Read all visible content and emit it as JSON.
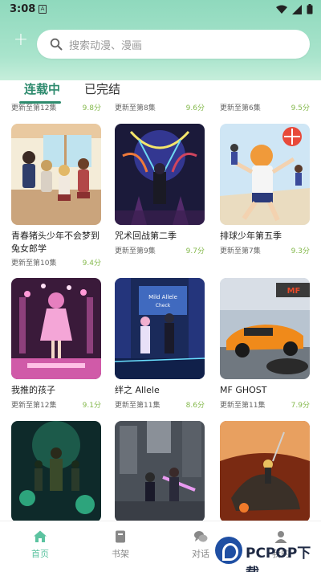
{
  "status": {
    "time": "3:08"
  },
  "search": {
    "placeholder": "搜索动漫、漫画"
  },
  "tabs": [
    {
      "label": "连载中"
    },
    {
      "label": "已完结"
    }
  ],
  "partial_row": [
    {
      "update": "更新至第12集",
      "score": "9.8分"
    },
    {
      "update": "更新至第8集",
      "score": "9.6分"
    },
    {
      "update": "更新至第6集",
      "score": "9.5分"
    }
  ],
  "cards": [
    {
      "title": "青春猪头少年不会梦到兔女郎学",
      "update": "更新至第10集",
      "score": "9.4分"
    },
    {
      "title": "咒术回战第二季",
      "update": "更新至第9集",
      "score": "9.7分"
    },
    {
      "title": "排球少年第五季",
      "update": "更新至第7集",
      "score": "9.3分"
    },
    {
      "title": "我推的孩子",
      "update": "更新至第12集",
      "score": "9.1分"
    },
    {
      "title": "绊之 Allele",
      "update": "更新至第11集",
      "score": "8.6分"
    },
    {
      "title": "MF GHOST",
      "update": "更新至第11集",
      "score": "7.9分"
    },
    {
      "title": "",
      "update": "",
      "score": ""
    },
    {
      "title": "",
      "update": "",
      "score": ""
    },
    {
      "title": "",
      "update": "",
      "score": ""
    }
  ],
  "covers": {
    "c3_sign": "MF",
    "c4_screen": "Mild Allele Check"
  },
  "nav": [
    {
      "label": "首页",
      "icon": "home-icon"
    },
    {
      "label": "书架",
      "icon": "bookshelf-icon"
    },
    {
      "label": "对话",
      "icon": "chat-icon"
    },
    {
      "label": "我的",
      "icon": "user-icon"
    }
  ],
  "watermark": {
    "text": "PCPOP下载"
  },
  "colors": {
    "accent": "#2e8b6e",
    "header": "#a9e4cc",
    "score": "#85b94d",
    "nav_active": "#5cc3a0"
  }
}
